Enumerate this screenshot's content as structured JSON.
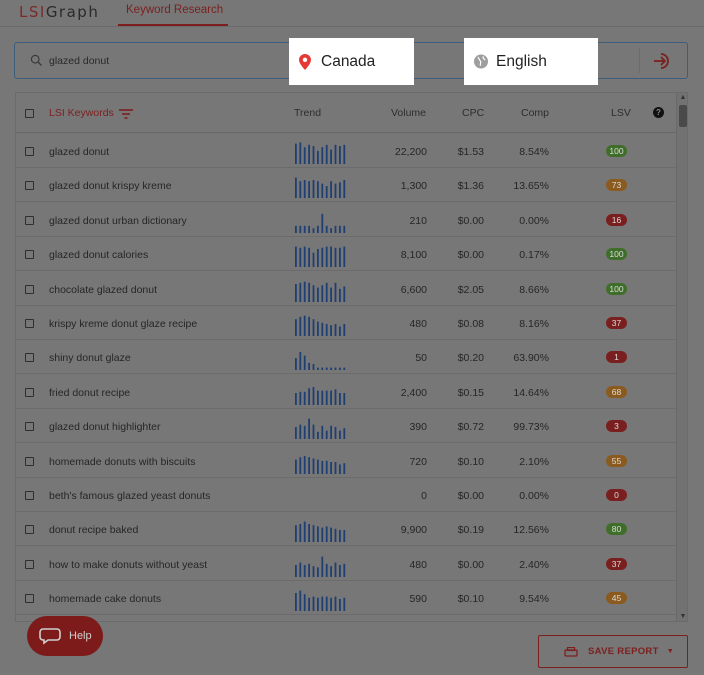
{
  "app": {
    "logo_lsi": "LSI",
    "logo_graph": "Graph",
    "active_tab": "Keyword Research"
  },
  "search": {
    "value": "glazed donut",
    "country": "Canada",
    "language": "English"
  },
  "table": {
    "headers": {
      "keyword": "LSI Keywords",
      "trend": "Trend",
      "volume": "Volume",
      "cpc": "CPC",
      "comp": "Comp",
      "lsv": "LSV",
      "help": "?"
    },
    "rows": [
      {
        "keyword": "glazed donut",
        "volume": "22,200",
        "cpc": "$1.53",
        "comp": "8.54%",
        "lsv": "100",
        "lsv_color": "#3f6e2a",
        "trend": [
          0.85,
          0.9,
          0.7,
          0.8,
          0.75,
          0.55,
          0.7,
          0.8,
          0.6,
          0.8,
          0.75,
          0.8
        ]
      },
      {
        "keyword": "glazed donut krispy kreme",
        "volume": "1,300",
        "cpc": "$1.36",
        "comp": "13.65%",
        "lsv": "73",
        "lsv_color": "#8a5a1e",
        "trend": [
          0.85,
          0.7,
          0.75,
          0.7,
          0.75,
          0.7,
          0.6,
          0.5,
          0.7,
          0.6,
          0.65,
          0.75
        ]
      },
      {
        "keyword": "glazed donut urban dictionary",
        "volume": "210",
        "cpc": "$0.00",
        "comp": "0.00%",
        "lsv": "16",
        "lsv_color": "#7a1f1f",
        "trend": [
          0.3,
          0.3,
          0.3,
          0.3,
          0.2,
          0.3,
          0.8,
          0.3,
          0.2,
          0.3,
          0.3,
          0.3
        ]
      },
      {
        "keyword": "glazed donut calories",
        "volume": "8,100",
        "cpc": "$0.00",
        "comp": "0.17%",
        "lsv": "100",
        "lsv_color": "#3f6e2a",
        "trend": [
          0.85,
          0.8,
          0.85,
          0.8,
          0.6,
          0.75,
          0.8,
          0.85,
          0.85,
          0.8,
          0.8,
          0.85
        ]
      },
      {
        "keyword": "chocolate glazed donut",
        "volume": "6,600",
        "cpc": "$2.05",
        "comp": "8.66%",
        "lsv": "100",
        "lsv_color": "#3f6e2a",
        "trend": [
          0.75,
          0.8,
          0.85,
          0.8,
          0.7,
          0.6,
          0.7,
          0.8,
          0.6,
          0.8,
          0.55,
          0.65
        ]
      },
      {
        "keyword": "krispy kreme donut glaze recipe",
        "volume": "480",
        "cpc": "$0.08",
        "comp": "8.16%",
        "lsv": "37",
        "lsv_color": "#7a1f1f",
        "trend": [
          0.7,
          0.8,
          0.85,
          0.8,
          0.7,
          0.6,
          0.55,
          0.5,
          0.45,
          0.5,
          0.4,
          0.5
        ]
      },
      {
        "keyword": "shiny donut glaze",
        "volume": "50",
        "cpc": "$0.20",
        "comp": "63.90%",
        "lsv": "1",
        "lsv_color": "#7a1f1f",
        "trend": [
          0.5,
          0.75,
          0.6,
          0.3,
          0.25,
          0.1,
          0.1,
          0.1,
          0.1,
          0.1,
          0.1,
          0.1
        ]
      },
      {
        "keyword": "fried donut recipe",
        "volume": "2,400",
        "cpc": "$0.15",
        "comp": "14.64%",
        "lsv": "68",
        "lsv_color": "#8a5a1e",
        "trend": [
          0.5,
          0.55,
          0.55,
          0.7,
          0.75,
          0.6,
          0.6,
          0.6,
          0.6,
          0.65,
          0.5,
          0.5
        ]
      },
      {
        "keyword": "glazed donut highlighter",
        "volume": "390",
        "cpc": "$0.72",
        "comp": "99.73%",
        "lsv": "3",
        "lsv_color": "#7a1f1f",
        "trend": [
          0.5,
          0.6,
          0.55,
          0.85,
          0.6,
          0.3,
          0.55,
          0.35,
          0.55,
          0.5,
          0.35,
          0.45
        ]
      },
      {
        "keyword": "homemade donuts with biscuits",
        "volume": "720",
        "cpc": "$0.10",
        "comp": "2.10%",
        "lsv": "55",
        "lsv_color": "#8a5a1e",
        "trend": [
          0.6,
          0.7,
          0.75,
          0.7,
          0.65,
          0.6,
          0.55,
          0.55,
          0.5,
          0.5,
          0.4,
          0.45
        ]
      },
      {
        "keyword": "beth's famous glazed yeast donuts",
        "volume": "0",
        "cpc": "$0.00",
        "comp": "0.00%",
        "lsv": "0",
        "lsv_color": "#7a1f1f",
        "trend": []
      },
      {
        "keyword": "donut recipe baked",
        "volume": "9,900",
        "cpc": "$0.19",
        "comp": "12.56%",
        "lsv": "80",
        "lsv_color": "#3f6e2a",
        "trend": [
          0.7,
          0.75,
          0.85,
          0.75,
          0.7,
          0.65,
          0.6,
          0.65,
          0.6,
          0.55,
          0.5,
          0.5
        ]
      },
      {
        "keyword": "how to make donuts without yeast",
        "volume": "480",
        "cpc": "$0.00",
        "comp": "2.40%",
        "lsv": "37",
        "lsv_color": "#7a1f1f",
        "trend": [
          0.5,
          0.6,
          0.5,
          0.55,
          0.45,
          0.4,
          0.85,
          0.55,
          0.45,
          0.6,
          0.5,
          0.55
        ]
      },
      {
        "keyword": "homemade cake donuts",
        "volume": "590",
        "cpc": "$0.10",
        "comp": "9.54%",
        "lsv": "45",
        "lsv_color": "#8a5a1e",
        "trend": [
          0.75,
          0.85,
          0.7,
          0.55,
          0.6,
          0.55,
          0.6,
          0.6,
          0.55,
          0.6,
          0.5,
          0.55
        ]
      }
    ]
  },
  "footer": {
    "help_label": "Help",
    "save_label": "SAVE REPORT"
  },
  "colors": {
    "accent": "#7d1f1f",
    "trend_bar": "#1f3f73",
    "focus_border": "#3d5d7c"
  }
}
